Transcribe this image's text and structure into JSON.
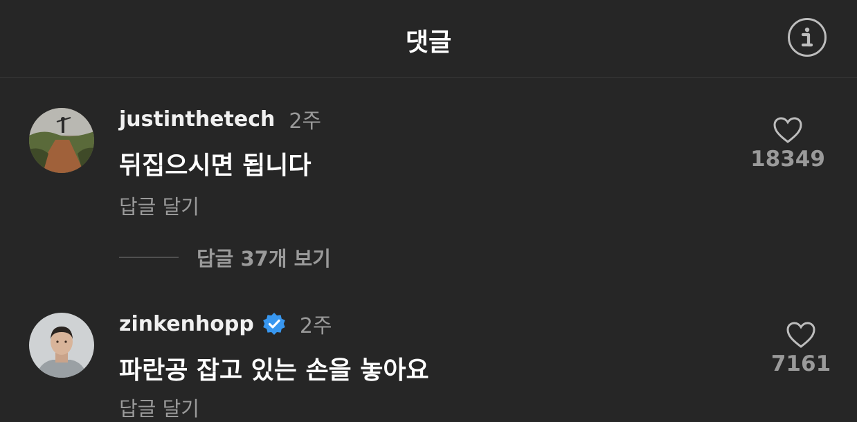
{
  "header": {
    "title": "댓글",
    "info_icon": "info-icon"
  },
  "comments": [
    {
      "username": "justinthetech",
      "verified": false,
      "time": "2주",
      "text": "뒤집으시면 됩니다",
      "reply_label": "답글 달기",
      "likes": "18349",
      "view_replies_label": "답글 37개 보기"
    },
    {
      "username": "zinkenhopp",
      "verified": true,
      "time": "2주",
      "text": "파란공 잡고 있는 손을 놓아요",
      "reply_label": "답글 달기",
      "likes": "7161"
    }
  ],
  "colors": {
    "background": "#262626",
    "verified_badge": "#3897f0",
    "secondary_text": "#9a9a9a"
  }
}
